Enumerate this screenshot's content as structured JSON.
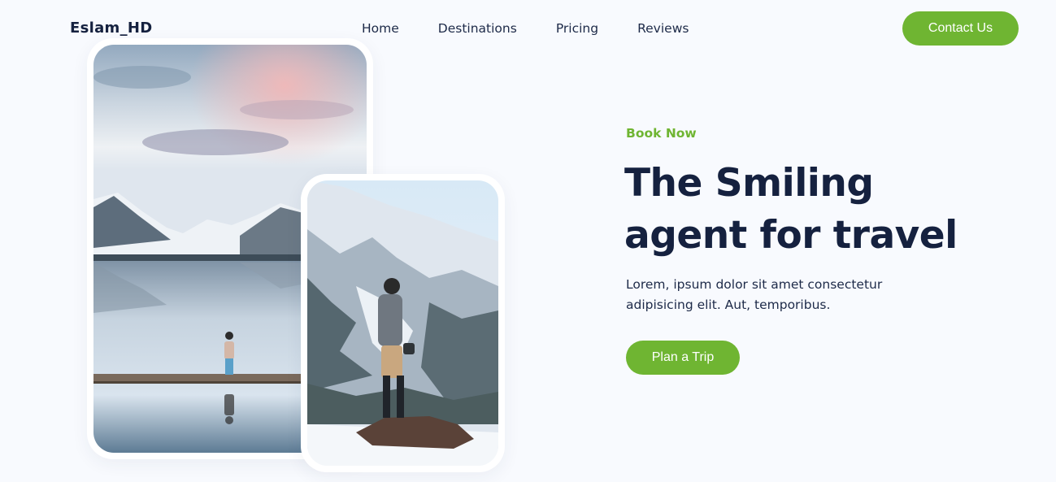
{
  "header": {
    "logo": "Eslam_HD",
    "nav": [
      "Home",
      "Destinations",
      "Pricing",
      "Reviews"
    ],
    "contact_label": "Contact Us"
  },
  "hero": {
    "eyebrow": "Book Now",
    "title_line1": "The Smiling",
    "title_line2": "agent for travel",
    "description": "Lorem, ipsum dolor sit amet consectetur adipisicing elit. Aut, temporibus.",
    "cta_label": "Plan a Trip"
  },
  "colors": {
    "accent": "#6fb532",
    "heading": "#15213f",
    "background": "#f8fafe"
  },
  "images": [
    "lake-reflection-photo",
    "snowy-mountain-hiker-photo"
  ]
}
